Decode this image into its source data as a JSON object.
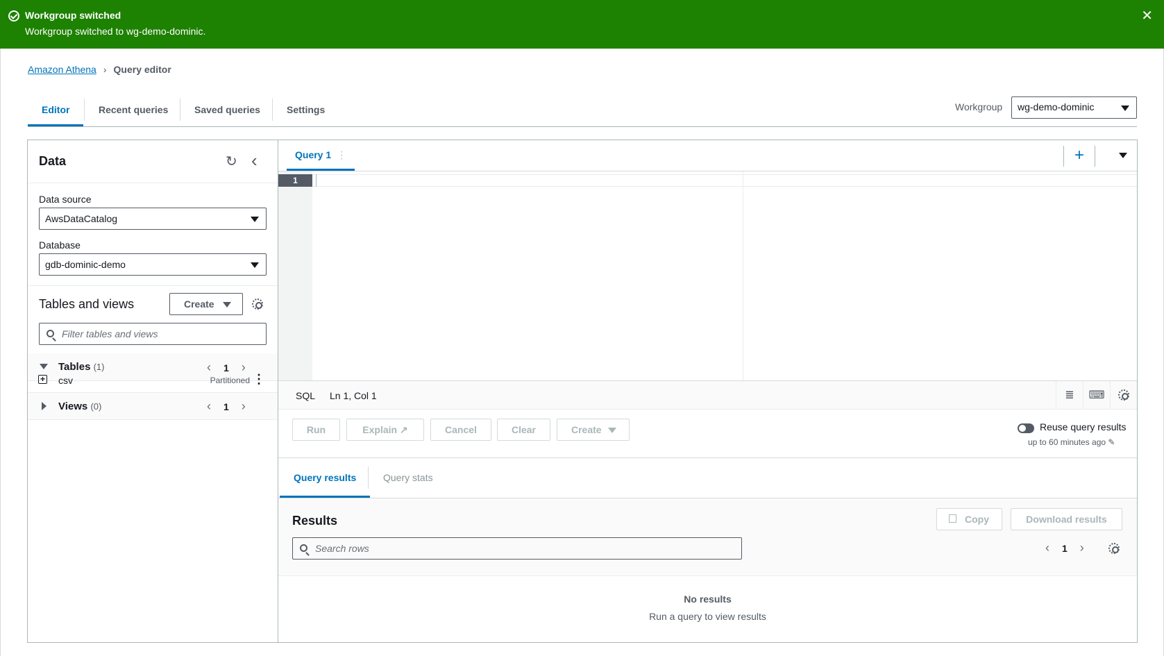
{
  "flash": {
    "title": "Workgroup switched",
    "message": "Workgroup switched to wg-demo-dominic.",
    "close": "✕"
  },
  "breadcrumb": {
    "root": "Amazon Athena",
    "separator": "›",
    "current": "Query editor"
  },
  "tabs": {
    "editor": "Editor",
    "recent": "Recent queries",
    "saved": "Saved queries",
    "settings": "Settings"
  },
  "workgroup": {
    "label": "Workgroup",
    "value": "wg-demo-dominic"
  },
  "data_panel": {
    "title": "Data",
    "refresh": "↻",
    "collapse": "‹",
    "data_source_label": "Data source",
    "data_source_value": "AwsDataCatalog",
    "database_label": "Database",
    "database_value": "gdb-dominic-demo",
    "tables_views_title": "Tables and views",
    "create_label": "Create",
    "filter_placeholder": "Filter tables and views",
    "tables_label": "Tables",
    "tables_count": "(1)",
    "tables_page": "1",
    "views_label": "Views",
    "views_count": "(0)",
    "views_page": "1",
    "table_rows": [
      {
        "name": "csv",
        "tag": "Partitioned"
      }
    ],
    "prev": "‹",
    "next": "›",
    "kebab": "⋮",
    "expand": "+"
  },
  "editor": {
    "tab_label": "Query 1",
    "tab_menu": "⋮",
    "add": "+",
    "line_number": "1",
    "language": "SQL",
    "position": "Ln 1, Col 1",
    "format_icon": "≣",
    "keyboard_icon": "⌨",
    "run": "Run",
    "explain": "Explain ↗",
    "cancel": "Cancel",
    "clear": "Clear",
    "create": "Create",
    "reuse_label": "Reuse query results",
    "reuse_sub": "up to 60 minutes ago ✎"
  },
  "results": {
    "tab_results": "Query results",
    "tab_stats": "Query stats",
    "title": "Results",
    "copy": "Copy",
    "download": "Download results",
    "search_placeholder": "Search rows",
    "page": "1",
    "prev": "‹",
    "next": "›",
    "empty_title": "No results",
    "empty_sub": "Run a query to view results"
  }
}
